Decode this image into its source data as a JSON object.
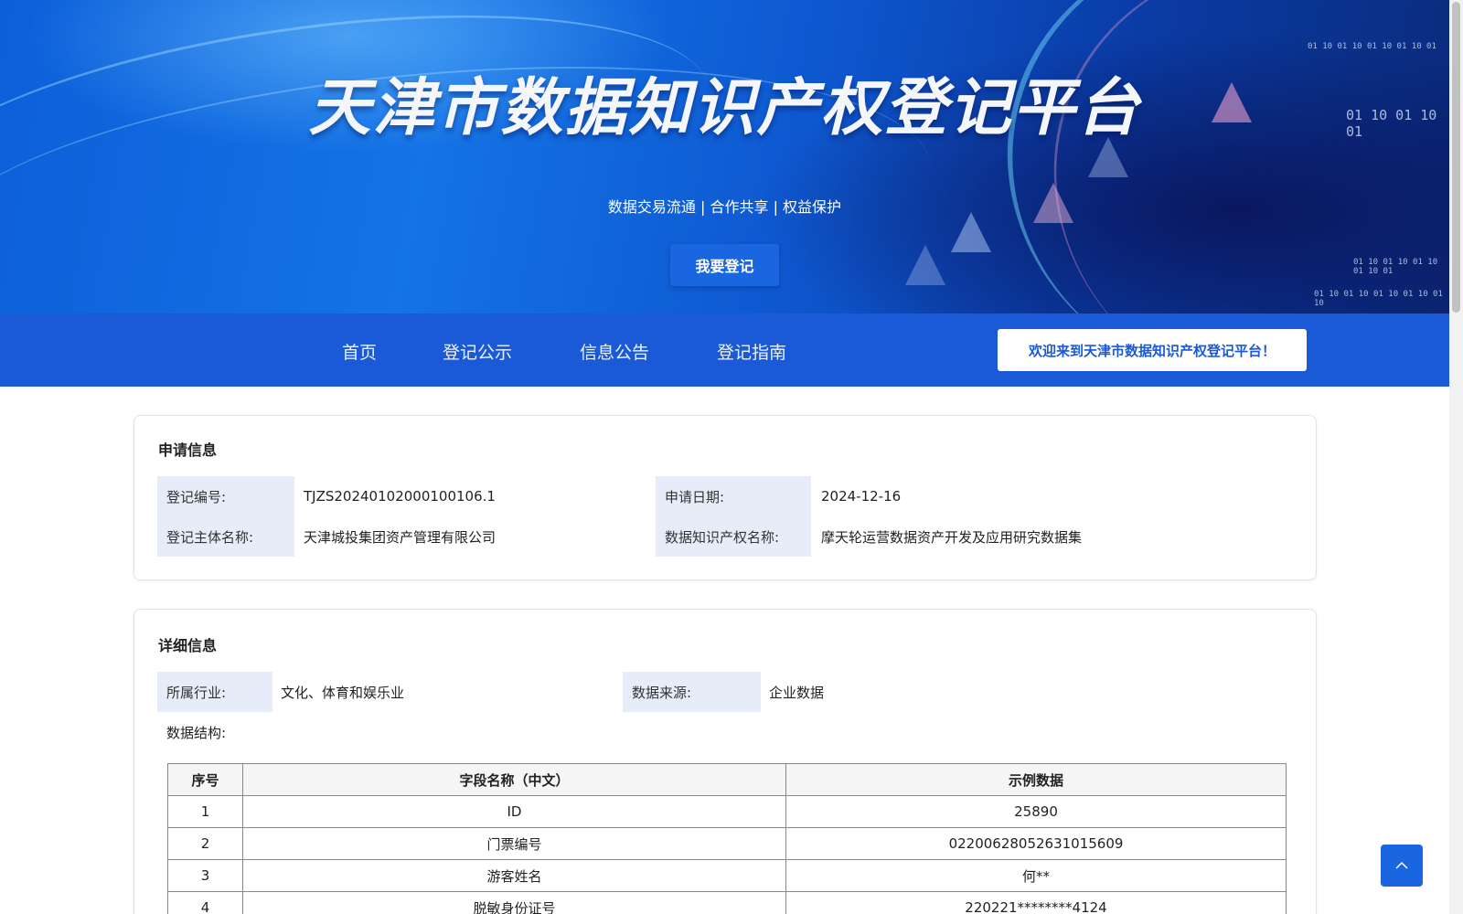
{
  "banner": {
    "title": "天津市数据知识产权登记平台",
    "subtitle": "数据交易流通 | 合作共享 | 权益保护",
    "register_button": "我要登记",
    "binary_1": "01 10 01 10 01 10 01 10 01",
    "binary_2": "01 10 01 10 01",
    "binary_3": "01 10 01 10 01 10 01 10 01",
    "binary_4": "01 10 01 10 01 10 01 10 01 10"
  },
  "nav": {
    "items": [
      "首页",
      "登记公示",
      "信息公告",
      "登记指南"
    ],
    "welcome": "欢迎来到天津市数据知识产权登记平台！"
  },
  "application": {
    "title": "申请信息",
    "reg_no_label": "登记编号:",
    "reg_no": "TJZS20240102000100106.1",
    "date_label": "申请日期:",
    "date": "2024-12-16",
    "subject_label": "登记主体名称:",
    "subject": "天津城投集团资产管理有限公司",
    "ip_name_label": "数据知识产权名称:",
    "ip_name": "摩天轮运营数据资产开发及应用研究数据集"
  },
  "detail": {
    "title": "详细信息",
    "industry_label": "所属行业:",
    "industry": "文化、体育和娱乐业",
    "source_label": "数据来源:",
    "source": "企业数据",
    "structure_label": "数据结构:",
    "columns": [
      "序号",
      "字段名称（中文）",
      "示例数据"
    ],
    "rows": [
      [
        "1",
        "ID",
        "25890"
      ],
      [
        "2",
        "门票编号",
        "02200628052631015609"
      ],
      [
        "3",
        "游客姓名",
        "何**"
      ],
      [
        "4",
        "脱敏身份证号",
        "220221********4124"
      ]
    ]
  },
  "colors": {
    "nav_bg": "#1a5ad6",
    "label_bg": "#e6ecf8",
    "button_blue": "#1a66e0"
  }
}
